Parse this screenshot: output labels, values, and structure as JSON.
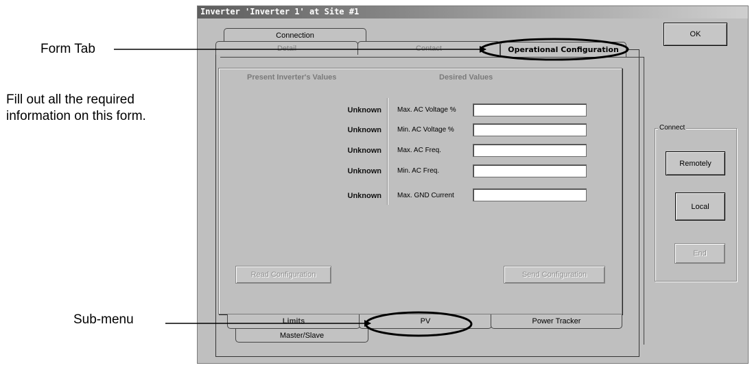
{
  "annotations": {
    "form_tab": "Form Tab",
    "instructions": "Fill out all the required information on this form.",
    "sub_menu": "Sub-menu"
  },
  "window": {
    "title": "Inverter 'Inverter 1' at Site #1"
  },
  "tabs": {
    "connection": "Connection",
    "detail": "Detail",
    "contact": "Contact",
    "operational_configuration": "Operational Configuration"
  },
  "form": {
    "present_header": "Present Inverter's Values",
    "desired_header": "Desired Values",
    "rows": [
      {
        "present": "Unknown",
        "label": "Max. AC Voltage %",
        "value": ""
      },
      {
        "present": "Unknown",
        "label": "Min. AC Voltage %",
        "value": ""
      },
      {
        "present": "Unknown",
        "label": "Max. AC Freq.",
        "value": ""
      },
      {
        "present": "Unknown",
        "label": "Min. AC Freq.",
        "value": ""
      },
      {
        "present": "Unknown",
        "label": "Max. GND Current",
        "value": ""
      }
    ],
    "read_button": "Read Configuration",
    "send_button": "Send Configuration"
  },
  "subtabs": {
    "limits": "Limits",
    "pv": "PV",
    "power_tracker": "Power Tracker",
    "master_slave": "Master/Slave"
  },
  "buttons": {
    "ok": "OK",
    "remotely": "Remotely",
    "local": "Local",
    "end": "End"
  },
  "connect_group": {
    "label": "Connect"
  }
}
